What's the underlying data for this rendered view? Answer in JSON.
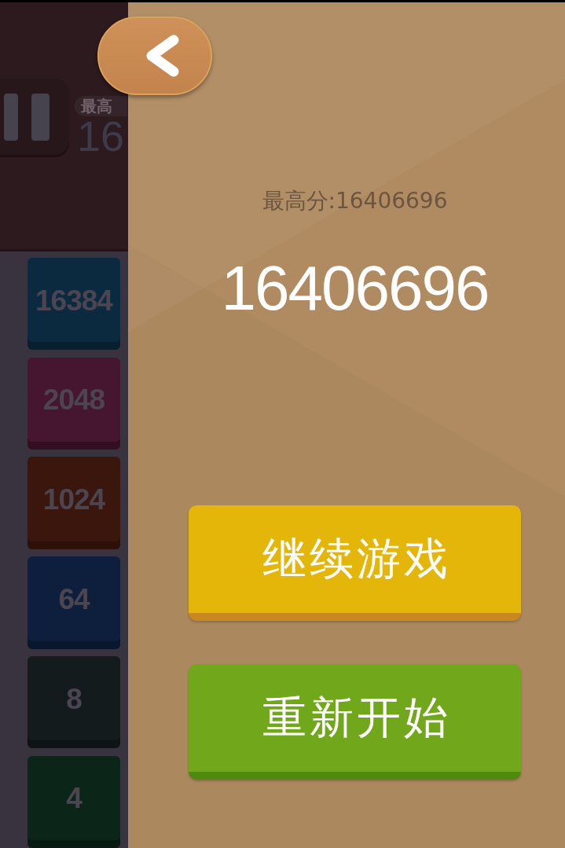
{
  "game_board": {
    "best_badge": "最高",
    "best_score": "16",
    "tiles": [
      {
        "value": "16384",
        "color": "#0c2a3f"
      },
      {
        "value": "2048",
        "color": "#461530"
      },
      {
        "value": "1024",
        "color": "#3b160d"
      },
      {
        "value": "64",
        "color": "#0d1f3d"
      },
      {
        "value": "8",
        "color": "#131b1d"
      },
      {
        "value": "4",
        "color": "#0b2519"
      }
    ]
  },
  "result_panel": {
    "best_score_label": "最高分:16406696",
    "score": "16406696",
    "buttons": [
      {
        "label": "继续游戏",
        "kind": "continue"
      },
      {
        "label": "重新开始",
        "kind": "restart"
      }
    ]
  }
}
